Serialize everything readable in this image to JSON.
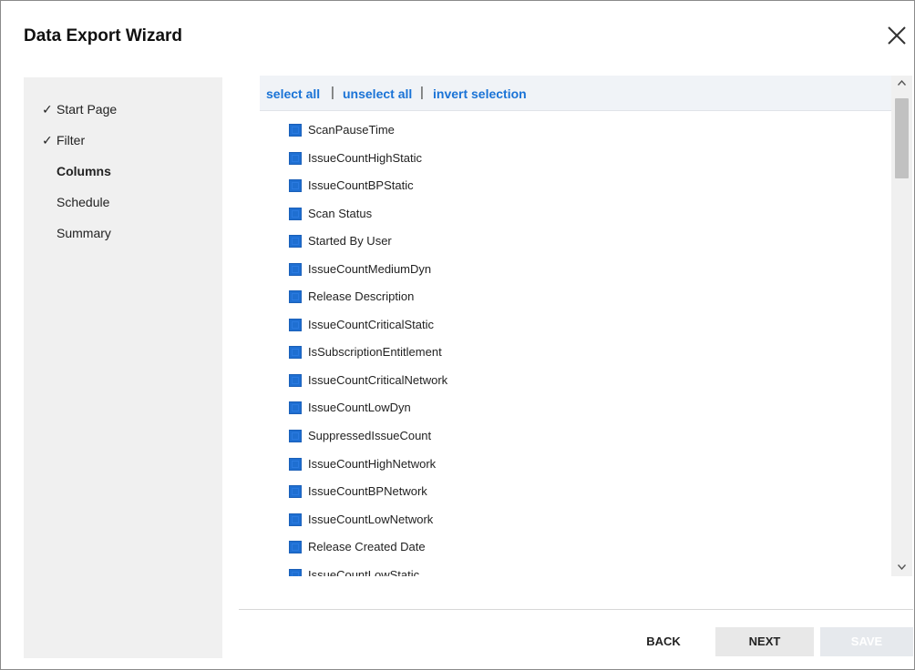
{
  "dialog": {
    "title": "Data Export Wizard"
  },
  "steps": [
    {
      "label": "Start Page",
      "check": "✓",
      "state": "done"
    },
    {
      "label": "Filter",
      "check": "✓",
      "state": "done"
    },
    {
      "label": "Columns",
      "check": "",
      "state": "current"
    },
    {
      "label": "Schedule",
      "check": "",
      "state": "pending"
    },
    {
      "label": "Summary",
      "check": "",
      "state": "pending"
    }
  ],
  "toolbar": {
    "select_all": "select all",
    "unselect_all": "unselect all",
    "invert_selection": "invert selection",
    "separator": "|"
  },
  "columns": [
    {
      "label": "ScanPauseTime",
      "checked": true
    },
    {
      "label": "IssueCountHighStatic",
      "checked": true
    },
    {
      "label": "IssueCountBPStatic",
      "checked": true
    },
    {
      "label": "Scan Status",
      "checked": true
    },
    {
      "label": "Started By User",
      "checked": true
    },
    {
      "label": "IssueCountMediumDyn",
      "checked": true
    },
    {
      "label": "Release Description",
      "checked": true
    },
    {
      "label": "IssueCountCriticalStatic",
      "checked": true
    },
    {
      "label": "IsSubscriptionEntitlement",
      "checked": true
    },
    {
      "label": "IssueCountCriticalNetwork",
      "checked": true
    },
    {
      "label": "IssueCountLowDyn",
      "checked": true
    },
    {
      "label": "SuppressedIssueCount",
      "checked": true
    },
    {
      "label": "IssueCountHighNetwork",
      "checked": true
    },
    {
      "label": "IssueCountBPNetwork",
      "checked": true
    },
    {
      "label": "IssueCountLowNetwork",
      "checked": true
    },
    {
      "label": "Release Created Date",
      "checked": true
    },
    {
      "label": "IssueCountLowStatic",
      "checked": true
    }
  ],
  "buttons": {
    "back": "BACK",
    "next": "NEXT",
    "save": "SAVE"
  },
  "colors": {
    "accent": "#1a73d6",
    "checkbox": "#1f6fd1",
    "sidebar_bg": "#f0f0f0",
    "toolbar_bg": "#f0f3f7"
  },
  "icons": {
    "close": "close-icon",
    "check": "check-icon",
    "scroll_up": "chevron-up-icon",
    "scroll_down": "chevron-down-icon"
  }
}
